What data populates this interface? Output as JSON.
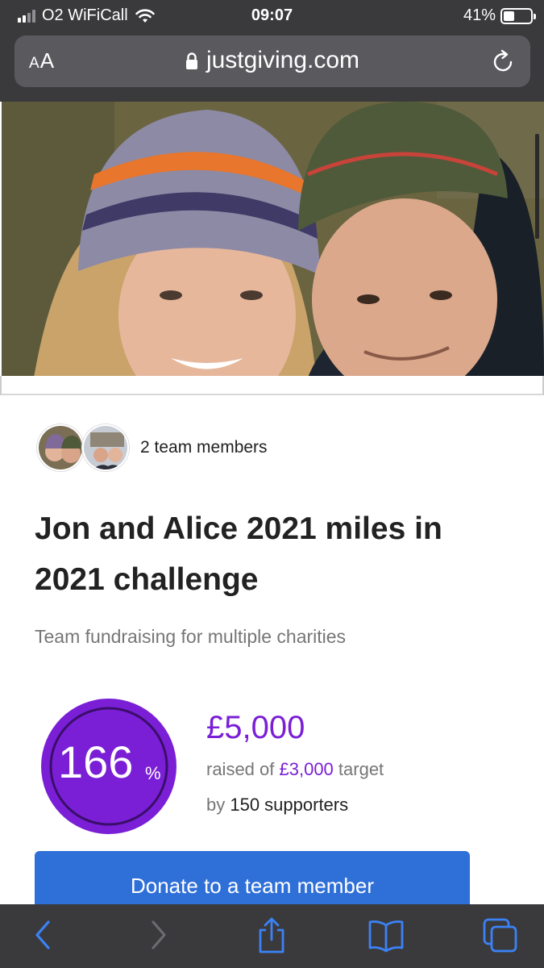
{
  "status_bar": {
    "carrier": "O2 WiFiCall",
    "time": "09:07",
    "battery_percent": "41%",
    "battery_level": 0.41
  },
  "browser": {
    "text_size_label_small": "A",
    "text_size_label_large": "A",
    "url": "justgiving.com"
  },
  "team": {
    "members_text": "2 team members"
  },
  "page": {
    "title": "Jon and Alice 2021 miles in 2021 challenge",
    "subtitle": "Team fundraising for multiple charities"
  },
  "fundraising": {
    "percent_value": "166",
    "percent_sign": "%",
    "percent_numeric": 166,
    "raised": "£5,000",
    "raised_of_prefix": "raised of ",
    "target": "£3,000",
    "target_suffix": " target",
    "by_prefix": "by ",
    "supporters": "150 supporters",
    "ring_color": "#7a1fd6"
  },
  "actions": {
    "donate_label": "Donate to a team member"
  },
  "colors": {
    "brand_purple": "#7a1fd6",
    "button_blue": "#2f6fd8",
    "chrome_dark": "#3a3a3c",
    "toolbar_icon_blue": "#3b82f6"
  },
  "icons": [
    "signal-icon",
    "wifi-icon",
    "battery-icon",
    "lock-icon",
    "reload-icon",
    "back-icon",
    "forward-icon",
    "share-icon",
    "bookmarks-icon",
    "tabs-icon"
  ]
}
